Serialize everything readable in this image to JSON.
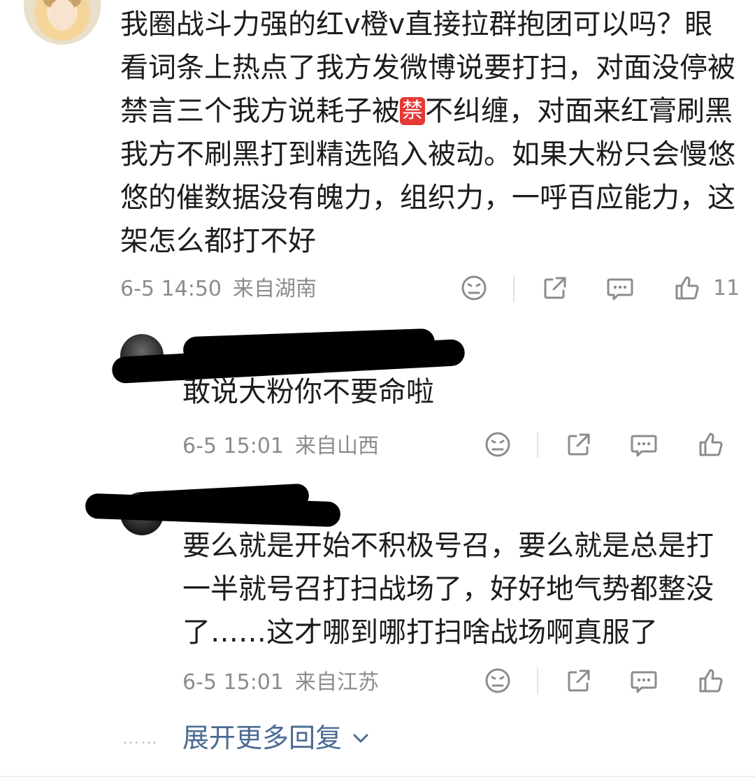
{
  "main_comment": {
    "text": "我圈战斗力强的红v橙v直接拉群抱团可以吗？眼看词条上热点了我方发微博说要打扫，对面没停被禁言三个我方说耗子被",
    "emoji": "禁",
    "text_after": "不纠缠，对面来红膏刷黑我方不刷黑打到精选陷入被动。如果大粉只会慢悠悠的催数据没有魄力，组织力，一呼百应能力，这架怎么都打不好",
    "time": "6-5 14:50",
    "location": "来自湖南",
    "likes": "11"
  },
  "replies": [
    {
      "text": "敢说大粉你不要命啦",
      "time": "6-5 15:01",
      "location": "来自山西"
    },
    {
      "text": "要么就是开始不积极号召，要么就是总是打一半就号召打扫战场了，好好地气势都整没了……这才哪到哪打扫啥战场啊真服了",
      "time": "6-5 15:01",
      "location": "来自江苏"
    }
  ],
  "expand": {
    "dots": "……",
    "label": "展开更多回复"
  },
  "icons": {
    "dislike": "sad-face-icon",
    "share": "share-icon",
    "comment": "comment-icon",
    "like": "thumbs-up-icon",
    "expand": "chevron-down-icon"
  },
  "colors": {
    "link": "#4a6a93",
    "meta": "#8c8c8c",
    "emoji_bg": "#e53935"
  }
}
